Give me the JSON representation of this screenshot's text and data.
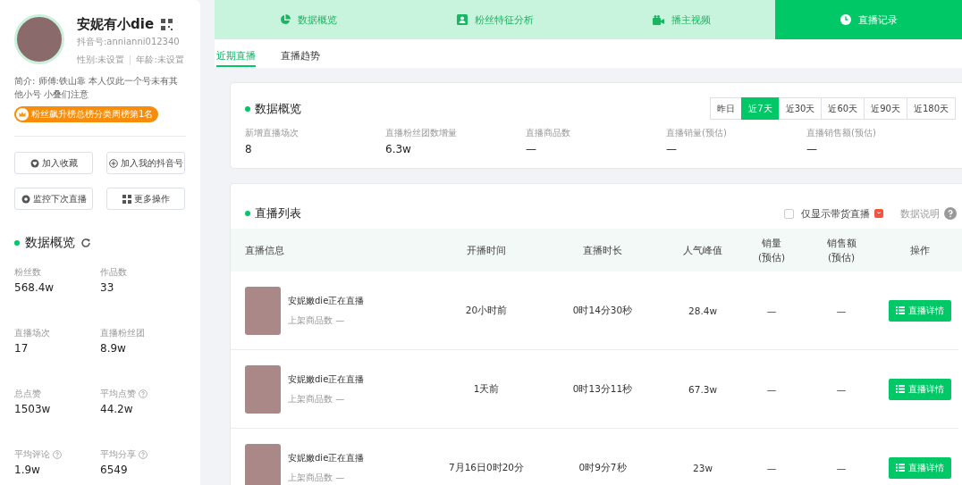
{
  "profile": {
    "name": "安妮有小die",
    "douyin_id": "抖音号:annianni012340",
    "gender": "性别:未设置",
    "age": "年龄:未设置",
    "bio": "简介: 师傅:铁山靠 本人仅此一个号未有其他小号 小叠们注意",
    "badge": "粉丝飙升榜总榜分类周榜第1名"
  },
  "actions": [
    {
      "label": "加入收藏",
      "kind": "favorite"
    },
    {
      "label": "加入我的抖音号",
      "kind": "add"
    },
    {
      "label": "监控下次直播",
      "kind": "monitor"
    },
    {
      "label": "更多操作",
      "kind": "more"
    }
  ],
  "overview": {
    "title": "数据概览",
    "stats": [
      {
        "label": "粉丝数",
        "value": "568.4w",
        "help": false
      },
      {
        "label": "作品数",
        "value": "33",
        "help": false
      },
      {
        "label": "直播场次",
        "value": "17",
        "help": false
      },
      {
        "label": "直播粉丝团",
        "value": "8.9w",
        "help": false
      },
      {
        "label": "总点赞",
        "value": "1503w",
        "help": false
      },
      {
        "label": "平均点赞",
        "value": "44.2w",
        "help": true
      },
      {
        "label": "平均评论",
        "value": "1.9w",
        "help": true
      },
      {
        "label": "平均分享",
        "value": "6549",
        "help": true
      }
    ]
  },
  "tabs": [
    {
      "label": "数据概览",
      "kind": "pie",
      "selected": false
    },
    {
      "label": "粉丝特征分析",
      "kind": "person",
      "selected": false
    },
    {
      "label": "播主视频",
      "kind": "video",
      "selected": false
    },
    {
      "label": "直播记录",
      "kind": "clock",
      "selected": true
    }
  ],
  "subtabs": [
    {
      "label": "近期直播",
      "selected": true
    },
    {
      "label": "直播趋势",
      "selected": false
    }
  ],
  "live_overview": {
    "title": "数据概览",
    "periods": [
      {
        "label": "昨日",
        "selected": false
      },
      {
        "label": "近7天",
        "selected": true
      },
      {
        "label": "近30天",
        "selected": false
      },
      {
        "label": "近60天",
        "selected": false
      },
      {
        "label": "近90天",
        "selected": false
      },
      {
        "label": "近180天",
        "selected": false
      }
    ],
    "metrics": [
      {
        "label": "新增直播场次",
        "value": "8"
      },
      {
        "label": "直播粉丝团数增量",
        "value": "6.3w"
      },
      {
        "label": "直播商品数",
        "value": "—"
      },
      {
        "label": "直播销量(预估)",
        "value": "—"
      },
      {
        "label": "直播销售额(预估)",
        "value": "—"
      }
    ]
  },
  "live_list": {
    "title": "直播列表",
    "filter": {
      "label": "仅显示带货直播",
      "checked": false
    },
    "help_label": "数据说明",
    "columns": [
      {
        "lines": [
          "直播信息"
        ]
      },
      {
        "lines": [
          "开播时间"
        ]
      },
      {
        "lines": [
          "直播时长"
        ]
      },
      {
        "lines": [
          "人气峰值"
        ]
      },
      {
        "lines": [
          "销量",
          "(预估)"
        ]
      },
      {
        "lines": [
          "销售额",
          "(预估)"
        ]
      },
      {
        "lines": [
          "操作"
        ]
      }
    ],
    "rows": [
      {
        "title": "安妮嫩die正在直播",
        "goods": "上架商品数 —",
        "start": "20小时前",
        "duration": "0时14分30秒",
        "peak": "28.4w",
        "sales": "—",
        "amount": "—",
        "action": "直播详情"
      },
      {
        "title": "安妮嫩die正在直播",
        "goods": "上架商品数 —",
        "start": "1天前",
        "duration": "0时13分11秒",
        "peak": "67.3w",
        "sales": "—",
        "amount": "—",
        "action": "直播详情"
      },
      {
        "title": "安妮嫩die正在直播",
        "goods": "上架商品数 —",
        "start": "7月16日0时20分",
        "duration": "0时9分7秒",
        "peak": "23w",
        "sales": "—",
        "amount": "—",
        "action": "直播详情"
      }
    ]
  }
}
